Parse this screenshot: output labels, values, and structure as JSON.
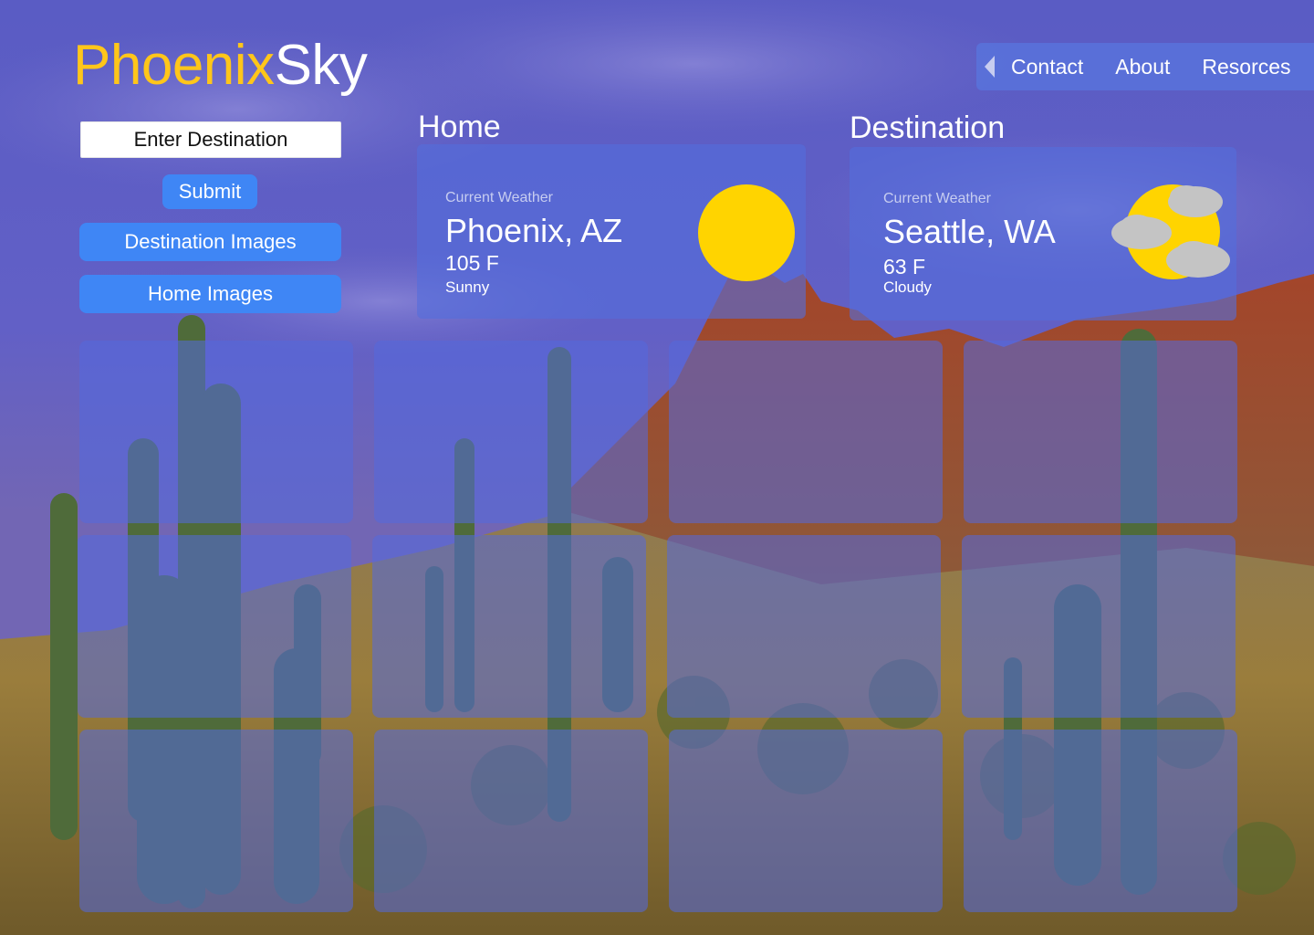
{
  "app": {
    "logo_part1": "Phoenix",
    "logo_part2": "Sky"
  },
  "nav": {
    "back_icon": "caret-left-icon",
    "items": [
      {
        "label": "Contact"
      },
      {
        "label": "About"
      },
      {
        "label": "Resorces"
      }
    ]
  },
  "controls": {
    "destination_placeholder": "Enter Destination",
    "submit_label": "Submit",
    "destination_images_label": "Destination Images",
    "home_images_label": "Home Images"
  },
  "home": {
    "heading": "Home",
    "caption": "Current Weather",
    "city": "Phoenix, AZ",
    "temperature": "105 F",
    "condition": "Sunny",
    "icon": "sun-icon"
  },
  "destination": {
    "heading": "Destination",
    "caption": "Current Weather",
    "city": "Seattle, WA",
    "temperature": "63 F",
    "condition": "Cloudy",
    "icon": "partly-cloudy-icon"
  },
  "colors": {
    "logo_accent": "#ffc61a",
    "button_blue": "#3f86f5",
    "sun_yellow": "#ffd400",
    "cloud_gray": "#c4c4c4",
    "panel_overlay": "#546ede"
  },
  "image_grid": {
    "rows": 3,
    "columns": 4
  }
}
